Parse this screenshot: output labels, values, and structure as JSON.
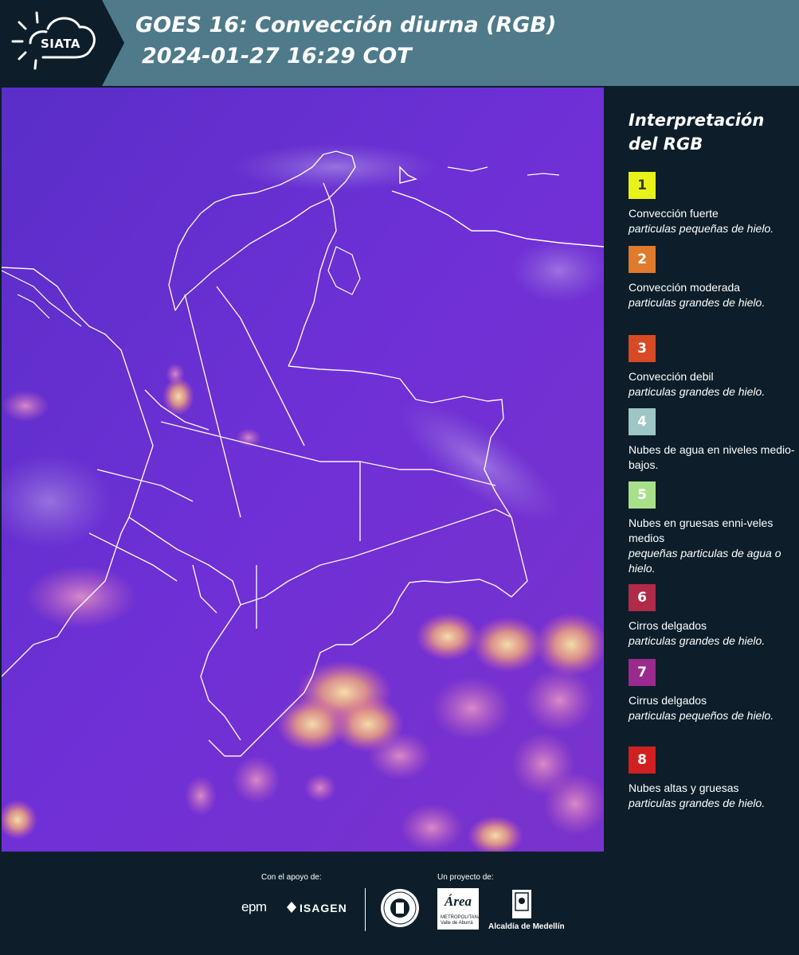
{
  "header": {
    "logo_text": "SIATA",
    "title_line1": "GOES 16: Convección diurna (RGB)",
    "title_line2": "2024-01-27 16:29 COT",
    "bg_color": "#4e7a8a"
  },
  "legend": {
    "title_line1": "Interpretación",
    "title_line2": "del RGB",
    "items": [
      {
        "number": "1",
        "color": "#e8f21a",
        "text_color": "#3a3a1a",
        "title": "Convección fuerte",
        "subtitle": "particulas pequeñas de hielo."
      },
      {
        "number": "2",
        "color": "#e07a2c",
        "text_color": "#ffffff",
        "title": "Convección moderada",
        "subtitle": "particulas grandes de hielo."
      },
      {
        "number": "3",
        "color": "#d84a26",
        "text_color": "#ffffff",
        "title": "Convección debil",
        "subtitle": "particulas grandes de hielo."
      },
      {
        "number": "4",
        "color": "#9dc6c4",
        "text_color": "#ffffff",
        "title": "Nubes de agua en niveles medio-bajos.",
        "subtitle": ""
      },
      {
        "number": "5",
        "color": "#a8e08a",
        "text_color": "#ffffff",
        "title": "Nubes en gruesas enni-veles medios",
        "subtitle": "pequeñas particulas de agua o hielo."
      },
      {
        "number": "6",
        "color": "#b02a4a",
        "text_color": "#ffffff",
        "title": "Cirros delgados",
        "subtitle": "particulas grandes de hielo."
      },
      {
        "number": "7",
        "color": "#9a2a8e",
        "text_color": "#ffffff",
        "title": "Cirrus delgados",
        "subtitle": "particulas pequeños de hielo."
      },
      {
        "number": "8",
        "color": "#d02020",
        "text_color": "#ffffff",
        "title": "Nubes altas y gruesas",
        "subtitle": "particulas grandes de hielo."
      }
    ]
  },
  "footer": {
    "support_label": "Con el apoyo de:",
    "project_label": "Un proyecto de:",
    "epm_logo": "epm",
    "isagen_logo": "ISAGEN",
    "area_script": "Área",
    "area_label": "METROPOLITANA Valle de Aburrá",
    "alcaldia_label": "Alcaldía de Medellín"
  },
  "map": {
    "background_color": "#6a2cd8",
    "cloud_colors": [
      "#f3a97a",
      "#e86a9a",
      "#b8a0e0"
    ]
  }
}
